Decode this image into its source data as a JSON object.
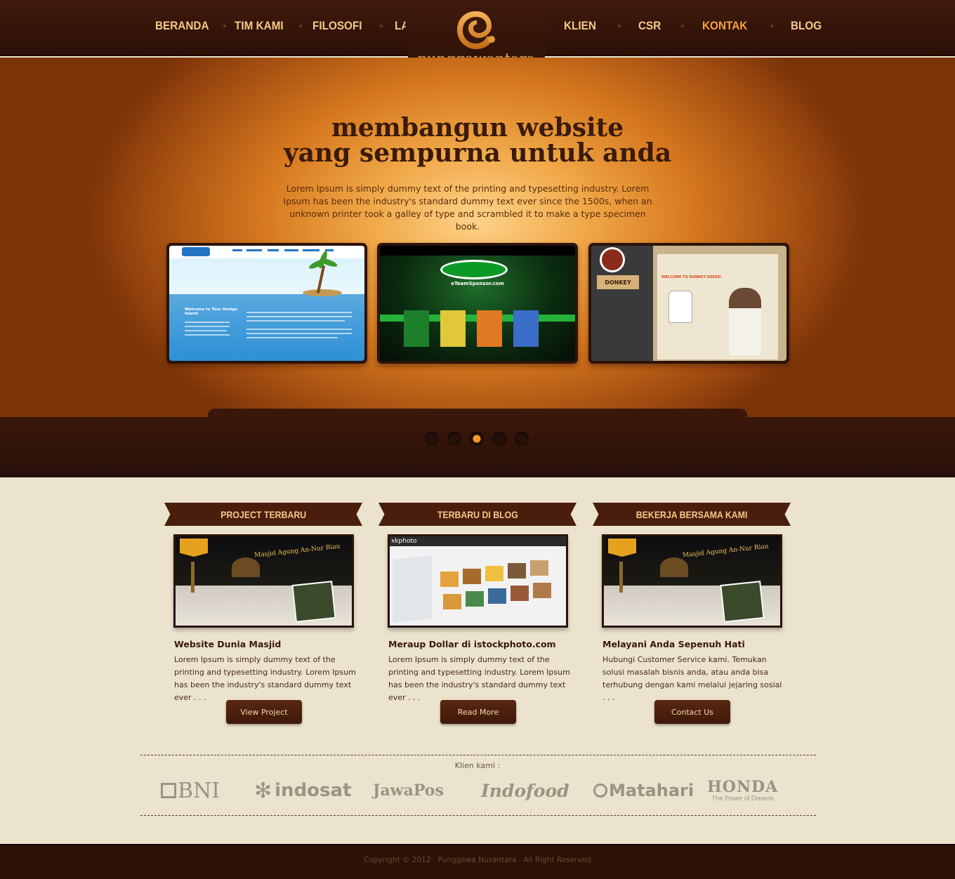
{
  "brand": {
    "name": "punggawantara",
    "accent": "#f7a23a",
    "dark": "#2d1006"
  },
  "nav": {
    "left": [
      {
        "label": "BERANDA",
        "active": false
      },
      {
        "label": "TIM KAMI",
        "active": false
      },
      {
        "label": "FILOSOFI",
        "active": false
      },
      {
        "label": "LAYANAN",
        "active": false
      }
    ],
    "right": [
      {
        "label": "KLIEN",
        "active": false
      },
      {
        "label": "CSR",
        "active": false
      },
      {
        "label": "KONTAK",
        "active": true
      },
      {
        "label": "BLOG",
        "active": false
      }
    ]
  },
  "hero": {
    "title_line1": "membangun website",
    "title_line2": "yang sempurna untuk anda",
    "text": "Lorem Ipsum is simply dummy text of the printing and typesetting industry. Lorem Ipsum has been the industry's standard dummy text ever since the 1500s, when an unknown printer took a galley of type and scrambled it to make a type specimen book.",
    "slides": [
      {
        "name": "Design Island",
        "heading": "Welcome to Your Design Island"
      },
      {
        "name": "eTeamSponsor",
        "heading": "eTeamSponsor.com"
      },
      {
        "name": "Donkey Deezo",
        "heading": "DONKEY",
        "welcome": "WELCOME TO DONKEY DEEZO!"
      }
    ],
    "slider_dots": 5,
    "active_dot": 3
  },
  "columns": [
    {
      "header": "PROJECT TERBARU",
      "title": "Website Dunia Masjid",
      "text": "Lorem Ipsum is simply dummy text of the printing and typesetting industry. Lorem Ipsum has been the industry's standard dummy text ever . . .",
      "button": "View Project",
      "thumb_caption": "Masjid Agung An-Nur Riau"
    },
    {
      "header": "TERBARU DI BLOG",
      "title": "Meraup Dollar di istockphoto.com",
      "text": "Lorem Ipsum is simply dummy text of the printing and typesetting industry. Lorem Ipsum has been the industry's standard dummy text ever . . .",
      "button": "Read More",
      "thumb_caption": "xkphoto"
    },
    {
      "header": "BEKERJA BERSAMA KAMI",
      "title": "Melayani Anda Sepenuh Hati",
      "text": "Hubungi Customer Service kami. Temukan solusi masalah bisnis anda, atau anda bisa terhubung dengan kami melalui jejaring sosial . . .",
      "button": "Contact Us",
      "thumb_caption": "Masjid Agung An-Nur Riau"
    }
  ],
  "clients": {
    "label": "Klien kami :",
    "logos": [
      "BNI",
      "indosat",
      "JawaPos",
      "Indofood",
      "Matahari",
      "HONDA"
    ],
    "honda_tagline": "The Power of Dreams"
  },
  "footer": {
    "copyright": "Copyright © 2012 . Punggawa Nusantara . All Right Reserved"
  }
}
